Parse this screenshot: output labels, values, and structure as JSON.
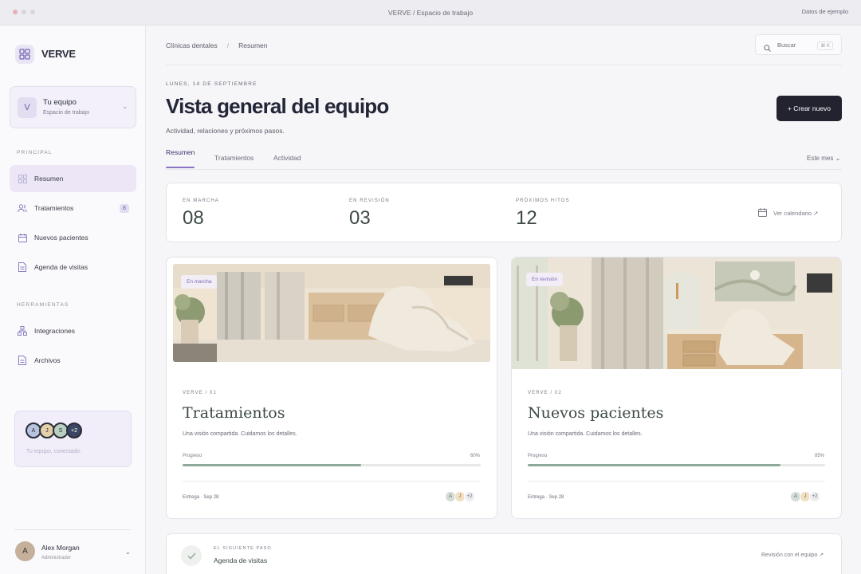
{
  "window": {
    "title": "VERVE / Espacio de trabajo",
    "sample_data": "Datos de ejemplo"
  },
  "sidebar": {
    "brand": "VERVE",
    "team": {
      "initial": "V",
      "name": "Tu equipo",
      "subtitle": "Espacio de trabajo"
    },
    "section_principal": "PRINCIPAL",
    "items": [
      {
        "label": "Resumen",
        "icon": "grid-icon",
        "active": true
      },
      {
        "label": "Tratamientos",
        "icon": "users-icon",
        "badge": "8"
      },
      {
        "label": "Nuevos pacientes",
        "icon": "calendar-icon"
      },
      {
        "label": "Agenda de visitas",
        "icon": "document-icon"
      }
    ],
    "section_tools": "HERRAMIENTAS",
    "tools": [
      {
        "label": "Integraciones",
        "icon": "integrations-icon"
      },
      {
        "label": "Archivos",
        "icon": "document-icon"
      }
    ],
    "promo": {
      "avatars": [
        "A",
        "J",
        "S",
        "+2"
      ],
      "text": "Tu equipo, conectado."
    },
    "user": {
      "initial": "A",
      "name": "Alex Morgan",
      "role": "Administrador"
    }
  },
  "header": {
    "breadcrumb": [
      "Clínicas dentales",
      "Resumen"
    ],
    "search_placeholder": "Buscar",
    "search_shortcut": "⌘ K"
  },
  "page": {
    "date": "LUNES, 14 DE SEPTIEMBRE",
    "title": "Vista general del equipo",
    "subtitle": "Actividad, relaciones y próximos pasos.",
    "create_button": "+ Crear nuevo",
    "tabs": [
      "Resumen",
      "Tratamientos",
      "Actividad"
    ],
    "period": "Este mes ⌄"
  },
  "stats": [
    {
      "label": "EN MARCHA",
      "value": "08"
    },
    {
      "label": "EN REVISIÓN",
      "value": "03"
    },
    {
      "label": "PRÓXIMOS HITOS",
      "value": "12"
    }
  ],
  "calendar_link": "Ver calendario ↗",
  "cards": [
    {
      "tag": "En marcha",
      "eyebrow": "VERVE / 01",
      "title": "Tratamientos",
      "description": "Una visión compartida. Cuidamos los detalles.",
      "progress_label": "Progreso",
      "progress": 60,
      "progress_text": "60%",
      "footer": "Entrega · Sep 28",
      "avatars": [
        "A",
        "J",
        "+2"
      ]
    },
    {
      "tag": "En revisión",
      "eyebrow": "VERVE / 02",
      "title": "Nuevos pacientes",
      "description": "Una visión compartida. Cuidamos los detalles.",
      "progress_label": "Progreso",
      "progress": 85,
      "progress_text": "85%",
      "footer": "Entrega · Sep 28",
      "avatars": [
        "A",
        "J",
        "+2"
      ]
    }
  ],
  "next_step": {
    "eyebrow": "EL SIGUIENTE PASO",
    "title": "Agenda de visitas",
    "link": "Revisión con el equipo ↗"
  },
  "colors": {
    "accent": "#8a72c4",
    "dark_button": "#23222f",
    "progress": "#8da99a"
  }
}
